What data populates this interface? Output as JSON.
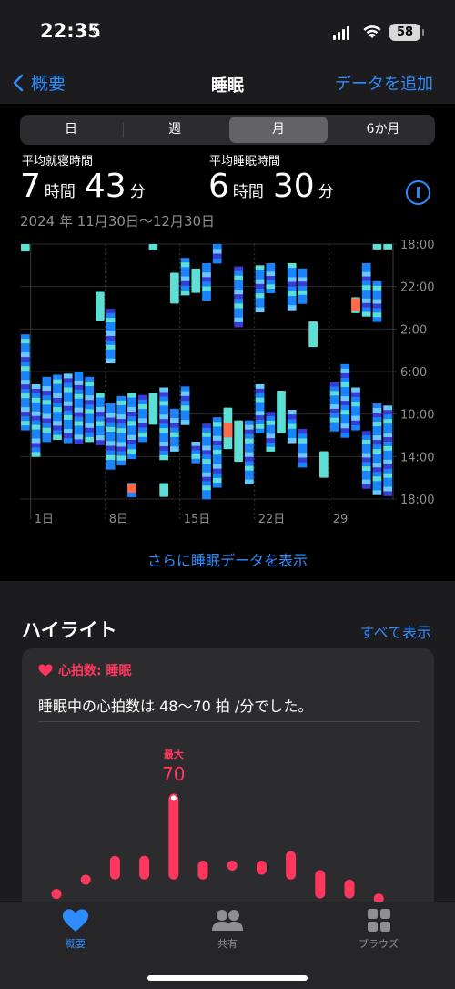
{
  "status": {
    "time": "22:35",
    "battery": "58"
  },
  "nav": {
    "back_label": "概要",
    "title": "睡眠",
    "add_label": "データを追加"
  },
  "segments": [
    "日",
    "週",
    "月",
    "6か月"
  ],
  "selected_segment": "月",
  "stats": {
    "bedtime_label": "平均就寝時間",
    "bedtime_hours": "7",
    "bedtime_minutes": "43",
    "sleep_label": "平均睡眠時間",
    "sleep_hours": "6",
    "sleep_minutes": "30",
    "unit_hour": "時間",
    "unit_minute": "分"
  },
  "date_range": "2024 年 11月30日〜12月30日",
  "chart_data": {
    "type": "bar",
    "y_ticks": [
      "18:00",
      "22:00",
      "2:00",
      "6:00",
      "10:00",
      "14:00",
      "18:00"
    ],
    "y_range_hours_from_18": [
      0,
      24
    ],
    "x_ticks": [
      "1日",
      "8日",
      "15日",
      "22日",
      "29"
    ],
    "colors": {
      "awake": "#ff6b4a",
      "rem": "#5ddfd6",
      "core": "#1a84ff",
      "deep": "#3a3ad6",
      "light": "#6ac8ff"
    },
    "bars": [
      {
        "day": 0,
        "start": 0.0,
        "end": 0.7,
        "kind": "rem"
      },
      {
        "day": 0,
        "start": 8.5,
        "end": 17.5,
        "kind": "core"
      },
      {
        "day": 1,
        "start": 13.2,
        "end": 20.0,
        "kind": "core"
      },
      {
        "day": 2,
        "start": 12.5,
        "end": 18.6,
        "kind": "core"
      },
      {
        "day": 3,
        "start": 12.3,
        "end": 18.4,
        "kind": "core"
      },
      {
        "day": 4,
        "start": 12.2,
        "end": 18.7,
        "kind": "core"
      },
      {
        "day": 5,
        "start": 12.0,
        "end": 18.8,
        "kind": "core"
      },
      {
        "day": 6,
        "start": 12.5,
        "end": 18.6,
        "kind": "core"
      },
      {
        "day": 7,
        "start": 4.5,
        "end": 7.2,
        "kind": "rem"
      },
      {
        "day": 7,
        "start": 14.0,
        "end": 18.9,
        "kind": "core"
      },
      {
        "day": 8,
        "start": 6.1,
        "end": 11.2,
        "kind": "core"
      },
      {
        "day": 8,
        "start": 15.0,
        "end": 21.2,
        "kind": "core"
      },
      {
        "day": 9,
        "start": 14.3,
        "end": 20.8,
        "kind": "core"
      },
      {
        "day": 10,
        "start": 22.5,
        "end": 23.8,
        "kind": "core"
      },
      {
        "day": 10,
        "start": 14.0,
        "end": 20.2,
        "kind": "core"
      },
      {
        "day": 11,
        "start": 14.2,
        "end": 18.6,
        "kind": "core"
      },
      {
        "day": 12,
        "start": 0.0,
        "end": 0.6,
        "kind": "rem"
      },
      {
        "day": 12,
        "start": 14.0,
        "end": 17.0,
        "kind": "rem"
      },
      {
        "day": 13,
        "start": 13.5,
        "end": 20.3,
        "kind": "core"
      },
      {
        "day": 13,
        "start": 22.5,
        "end": 23.8,
        "kind": "rem"
      },
      {
        "day": 14,
        "start": 2.7,
        "end": 5.6,
        "kind": "rem"
      },
      {
        "day": 14,
        "start": 15.5,
        "end": 19.5,
        "kind": "core"
      },
      {
        "day": 15,
        "start": 1.3,
        "end": 4.8,
        "kind": "core"
      },
      {
        "day": 15,
        "start": 13.4,
        "end": 17.0,
        "kind": "core"
      },
      {
        "day": 16,
        "start": 2.3,
        "end": 4.6,
        "kind": "rem"
      },
      {
        "day": 16,
        "start": 18.6,
        "end": 20.6,
        "kind": "core"
      },
      {
        "day": 17,
        "start": 1.8,
        "end": 5.3,
        "kind": "core"
      },
      {
        "day": 17,
        "start": 16.9,
        "end": 24.0,
        "kind": "core"
      },
      {
        "day": 18,
        "start": 0.0,
        "end": 1.8,
        "kind": "core"
      },
      {
        "day": 18,
        "start": 16.3,
        "end": 22.9,
        "kind": "core"
      },
      {
        "day": 19,
        "start": 15.4,
        "end": 19.3,
        "kind": "rem"
      },
      {
        "day": 20,
        "start": 16.6,
        "end": 20.5,
        "kind": "rem"
      },
      {
        "day": 20,
        "start": 2.1,
        "end": 7.8,
        "kind": "core"
      },
      {
        "day": 21,
        "start": 16.6,
        "end": 22.6,
        "kind": "core"
      },
      {
        "day": 22,
        "start": 2.0,
        "end": 6.4,
        "kind": "core"
      },
      {
        "day": 22,
        "start": 13.2,
        "end": 17.8,
        "kind": "core"
      },
      {
        "day": 23,
        "start": 1.8,
        "end": 4.6,
        "kind": "core"
      },
      {
        "day": 23,
        "start": 15.8,
        "end": 19.5,
        "kind": "core"
      },
      {
        "day": 24,
        "start": 13.8,
        "end": 17.8,
        "kind": "rem"
      },
      {
        "day": 25,
        "start": 1.8,
        "end": 6.2,
        "kind": "core"
      },
      {
        "day": 25,
        "start": 15.6,
        "end": 18.7,
        "kind": "core"
      },
      {
        "day": 26,
        "start": 2.3,
        "end": 5.6,
        "kind": "core"
      },
      {
        "day": 26,
        "start": 17.4,
        "end": 21.0,
        "kind": "core"
      },
      {
        "day": 27,
        "start": 7.3,
        "end": 9.7,
        "kind": "rem"
      },
      {
        "day": 28,
        "start": 19.5,
        "end": 22.0,
        "kind": "rem"
      },
      {
        "day": 29,
        "start": 13.0,
        "end": 17.6,
        "kind": "core"
      },
      {
        "day": 30,
        "start": 11.3,
        "end": 18.2,
        "kind": "core"
      },
      {
        "day": 31,
        "start": 5.0,
        "end": 6.5,
        "kind": "rem"
      },
      {
        "day": 31,
        "start": 13.5,
        "end": 17.5,
        "kind": "core"
      },
      {
        "day": 32,
        "start": 1.8,
        "end": 6.8,
        "kind": "core"
      },
      {
        "day": 32,
        "start": 17.6,
        "end": 23.0,
        "kind": "core"
      },
      {
        "day": 33,
        "start": 0.0,
        "end": 0.5,
        "kind": "rem"
      },
      {
        "day": 33,
        "start": 3.5,
        "end": 7.3,
        "kind": "core"
      },
      {
        "day": 33,
        "start": 15.0,
        "end": 23.6,
        "kind": "core"
      },
      {
        "day": 34,
        "start": 0.0,
        "end": 0.5,
        "kind": "rem"
      },
      {
        "day": 34,
        "start": 15.2,
        "end": 23.7,
        "kind": "core"
      }
    ],
    "awake_marks": [
      {
        "day": 10,
        "start": 22.6,
        "end": 23.4
      },
      {
        "day": 19,
        "start": 16.8,
        "end": 18.2
      },
      {
        "day": 31,
        "start": 5.1,
        "end": 6.3
      }
    ]
  },
  "more_link": "さらに睡眠データを表示",
  "highlights": {
    "title": "ハイライト",
    "see_all": "すべて表示"
  },
  "hr_card": {
    "category": "心拍数: 睡眠",
    "message": "睡眠中の心拍数は 48〜70 拍 /分でした。",
    "max_label": "最大",
    "max_value": "70",
    "ranges": [
      {
        "low": 50,
        "high": 50
      },
      {
        "low": 51,
        "high": 53
      },
      {
        "low": 52,
        "high": 57
      },
      {
        "low": 52,
        "high": 57
      },
      {
        "low": 52,
        "high": 70
      },
      {
        "low": 52,
        "high": 56
      },
      {
        "low": 56,
        "high": 56
      },
      {
        "low": 53,
        "high": 56
      },
      {
        "low": 52,
        "high": 58
      },
      {
        "low": 48,
        "high": 54
      },
      {
        "low": 48,
        "high": 52
      },
      {
        "low": 49,
        "high": 49
      }
    ],
    "y_min": 45,
    "y_max": 72,
    "color": "#ff375f"
  },
  "tabs": [
    {
      "label": "概要",
      "icon": "heart-icon",
      "active": true
    },
    {
      "label": "共有",
      "icon": "people-icon",
      "active": false
    },
    {
      "label": "ブラウズ",
      "icon": "grid-icon",
      "active": false
    }
  ]
}
